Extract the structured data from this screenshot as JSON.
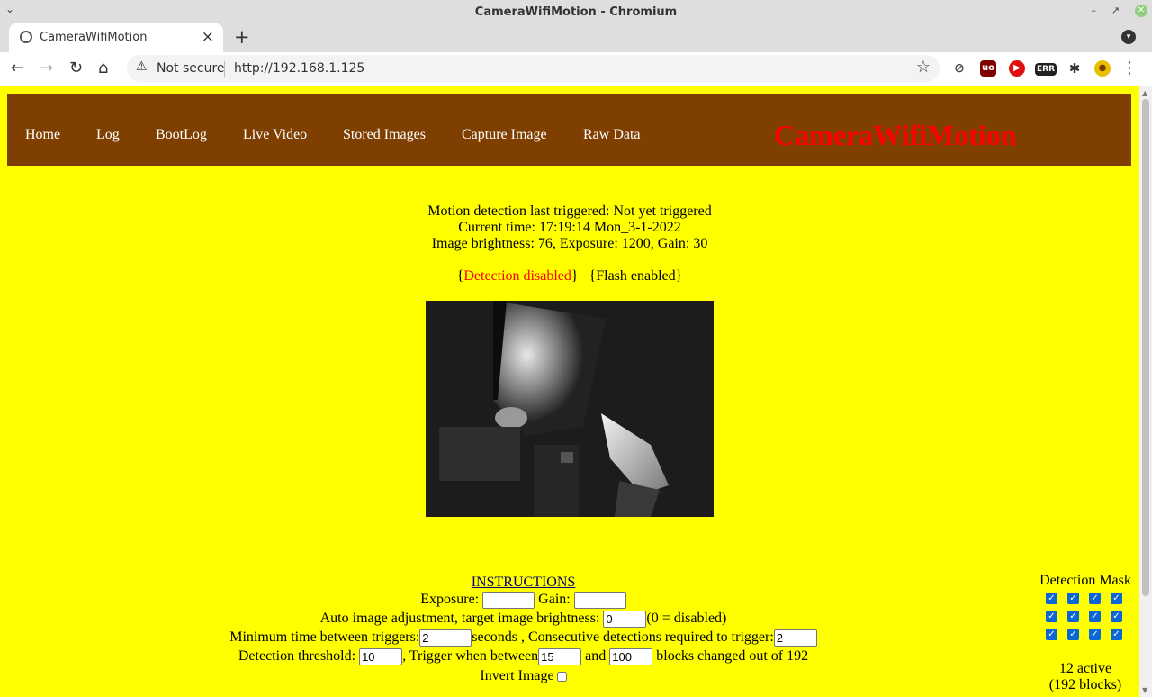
{
  "window": {
    "title": "CameraWifiMotion - Chromium"
  },
  "tab": {
    "title": "CameraWifiMotion"
  },
  "address_bar": {
    "security": "Not secure",
    "url": "http://192.168.1.125"
  },
  "extensions": [
    {
      "icon": "eye-slash-icon",
      "color": "#444444"
    },
    {
      "icon": "ublock-icon",
      "label": "uo",
      "color": "#800000"
    },
    {
      "icon": "shield-icon",
      "color": "#e01010"
    },
    {
      "icon": "err-icon",
      "label": "ERR",
      "color": "#222222"
    },
    {
      "icon": "puzzle-icon",
      "color": "#333333"
    },
    {
      "icon": "avatar-icon",
      "color": "#e8c000"
    }
  ],
  "nav": {
    "items": [
      "Home",
      "Log",
      "BootLog",
      "Live Video",
      "Stored Images",
      "Capture Image",
      "Raw Data"
    ],
    "brand": "CameraWifiMotion",
    "bg_color": "#7f3f00",
    "brand_color": "#ff0000"
  },
  "status": {
    "last_triggered_label": "Motion detection last triggered:",
    "last_triggered_value": "Not yet triggered",
    "current_time_label": "Current time:",
    "current_time_value": "17:19:14 Mon_3-1-2022",
    "brightness_label": "Image brightness:",
    "brightness_value": "76",
    "exposure_label": "Exposure:",
    "exposure_value": "1200",
    "gain_label": "Gain:",
    "gain_value": "30",
    "detection_state": "Detection disabled",
    "flash_state": "Flash enabled"
  },
  "form": {
    "instructions_link": "INSTRUCTIONS",
    "exposure_label": "Exposure:",
    "exposure_value": "",
    "gain_label": "Gain:",
    "gain_value": "",
    "auto_adjust_label": "Auto image adjustment, target image brightness:",
    "auto_adjust_value": "0",
    "auto_adjust_note": "(0 = disabled)",
    "min_time_label": "Minimum time between triggers:",
    "min_time_value": "2",
    "seconds_label": "seconds , Consecutive detections required to trigger:",
    "consecutive_value": "2",
    "threshold_label": "Detection threshold:",
    "threshold_value": "10",
    "trigger_between_label": ", Trigger when between",
    "trigger_min_value": "15",
    "and_label": "and",
    "trigger_max_value": "100",
    "blocks_label": "blocks changed out of 192",
    "invert_label": "Invert Image",
    "invert_checked": false
  },
  "mask": {
    "title": "Detection Mask",
    "rows": [
      [
        true,
        true,
        true,
        true
      ],
      [
        true,
        true,
        true,
        true
      ],
      [
        true,
        true,
        true,
        true
      ]
    ],
    "active_text": "12 active",
    "blocks_text": "(192 blocks)"
  }
}
